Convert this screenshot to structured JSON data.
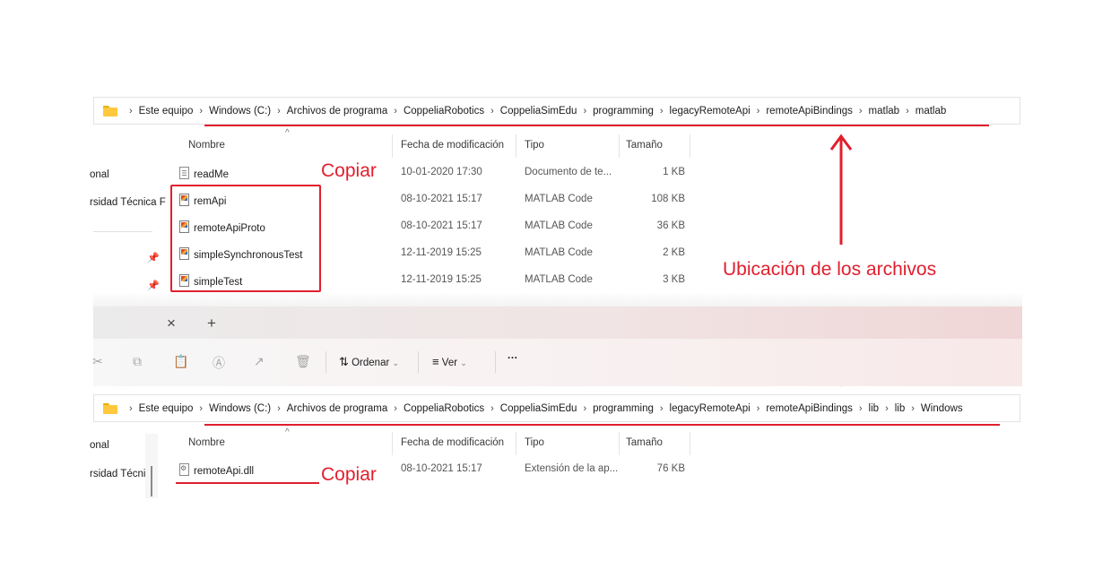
{
  "top_window": {
    "breadcrumbs": [
      "Este equipo",
      "Windows (C:)",
      "Archivos de programa",
      "CoppeliaRobotics",
      "CoppeliaSimEdu",
      "programming",
      "legacyRemoteApi",
      "remoteApiBindings",
      "matlab",
      "matlab"
    ],
    "sidebar": [
      "onal",
      "rsidad Técnica F"
    ],
    "columns": {
      "name": "Nombre",
      "date": "Fecha de modificación",
      "type": "Tipo",
      "size": "Tamaño"
    },
    "files": [
      {
        "name": "readMe",
        "date": "10-01-2020 17:30",
        "type": "Documento de te...",
        "size": "1 KB",
        "icon": "text-file-icon"
      },
      {
        "name": "remApi",
        "date": "08-10-2021 15:17",
        "type": "MATLAB Code",
        "size": "108 KB",
        "icon": "matlab-file-icon"
      },
      {
        "name": "remoteApiProto",
        "date": "08-10-2021 15:17",
        "type": "MATLAB Code",
        "size": "36 KB",
        "icon": "matlab-file-icon"
      },
      {
        "name": "simpleSynchronousTest",
        "date": "12-11-2019 15:25",
        "type": "MATLAB Code",
        "size": "2 KB",
        "icon": "matlab-file-icon"
      },
      {
        "name": "simpleTest",
        "date": "12-11-2019 15:25",
        "type": "MATLAB Code",
        "size": "3 KB",
        "icon": "matlab-file-icon"
      }
    ]
  },
  "tab_bar": {
    "close": "×",
    "new_tab": "+"
  },
  "toolbar": {
    "sort_label": "Ordenar",
    "view_label": "Ver",
    "more": "···",
    "sort_icon": "sort-icon",
    "view_icon": "view-icon"
  },
  "bottom_window": {
    "breadcrumbs": [
      "Este equipo",
      "Windows (C:)",
      "Archivos de programa",
      "CoppeliaRobotics",
      "CoppeliaSimEdu",
      "programming",
      "legacyRemoteApi",
      "remoteApiBindings",
      "lib",
      "lib",
      "Windows"
    ],
    "sidebar": [
      "onal",
      "rsidad Técnic"
    ],
    "columns": {
      "name": "Nombre",
      "date": "Fecha de modificación",
      "type": "Tipo",
      "size": "Tamaño"
    },
    "files": [
      {
        "name": "remoteApi.dll",
        "date": "08-10-2021 15:17",
        "type": "Extensión de la ap...",
        "size": "76 KB",
        "icon": "dll-file-icon"
      }
    ]
  },
  "annotations": {
    "copy_top": "Copiar",
    "copy_bottom": "Copiar",
    "location": "Ubicación de los archivos",
    "color": "#e01f2e"
  }
}
